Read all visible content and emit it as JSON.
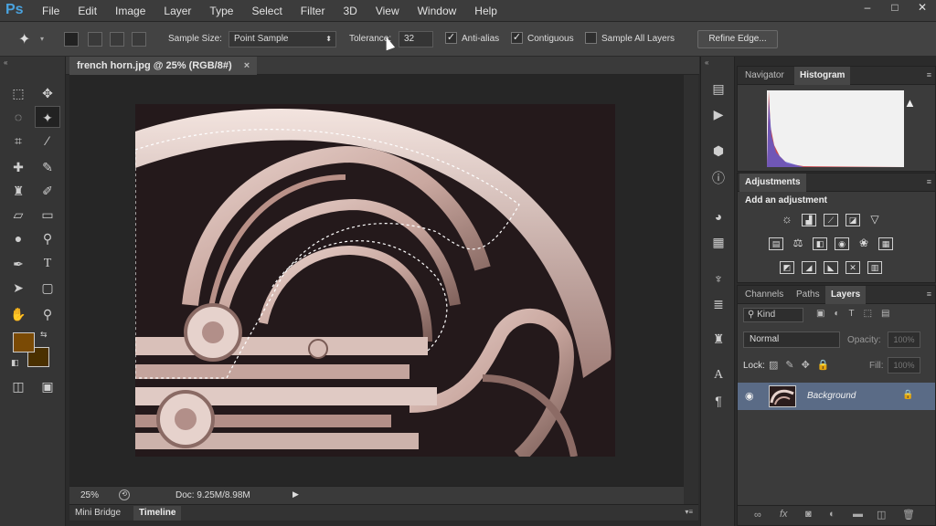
{
  "app": {
    "logo": "Ps",
    "menu": [
      "File",
      "Edit",
      "Image",
      "Layer",
      "Type",
      "Select",
      "Filter",
      "3D",
      "View",
      "Window",
      "Help"
    ],
    "window_controls": [
      "–",
      "□",
      "✕"
    ]
  },
  "options": {
    "sample_size_label": "Sample Size:",
    "sample_size_value": "Point Sample",
    "tolerance_label": "Tolerance:",
    "tolerance_value": "32",
    "anti_alias_label": "Anti-alias",
    "anti_alias_checked": true,
    "contiguous_label": "Contiguous",
    "contiguous_checked": true,
    "sample_all_layers_label": "Sample All Layers",
    "sample_all_layers_checked": false,
    "refine_edge_label": "Refine Edge..."
  },
  "document": {
    "tab_title": "french horn.jpg @ 25% (RGB/8#)",
    "tab_close": "×",
    "zoom": "25%",
    "doc_info": "Doc: 9.25M/8.98M"
  },
  "colors": {
    "foreground": "#7a4a05",
    "background": "#4a3000",
    "accent_blue": "#4aa3df",
    "layer_selected": "#5a6b86"
  },
  "bottom_tabs": [
    "Mini Bridge",
    "Timeline"
  ],
  "panels": {
    "top_tabs": [
      "Navigator",
      "Histogram"
    ],
    "adjustments_tab": "Adjustments",
    "add_adjustment_label": "Add an adjustment",
    "layers_tabs": [
      "Channels",
      "Paths",
      "Layers"
    ],
    "kind_filter": "Kind",
    "blend_mode": "Normal",
    "opacity_label": "Opacity:",
    "opacity_value": "100%",
    "lock_label": "Lock:",
    "fill_label": "Fill:",
    "fill_value": "100%",
    "layer_name": "Background"
  }
}
